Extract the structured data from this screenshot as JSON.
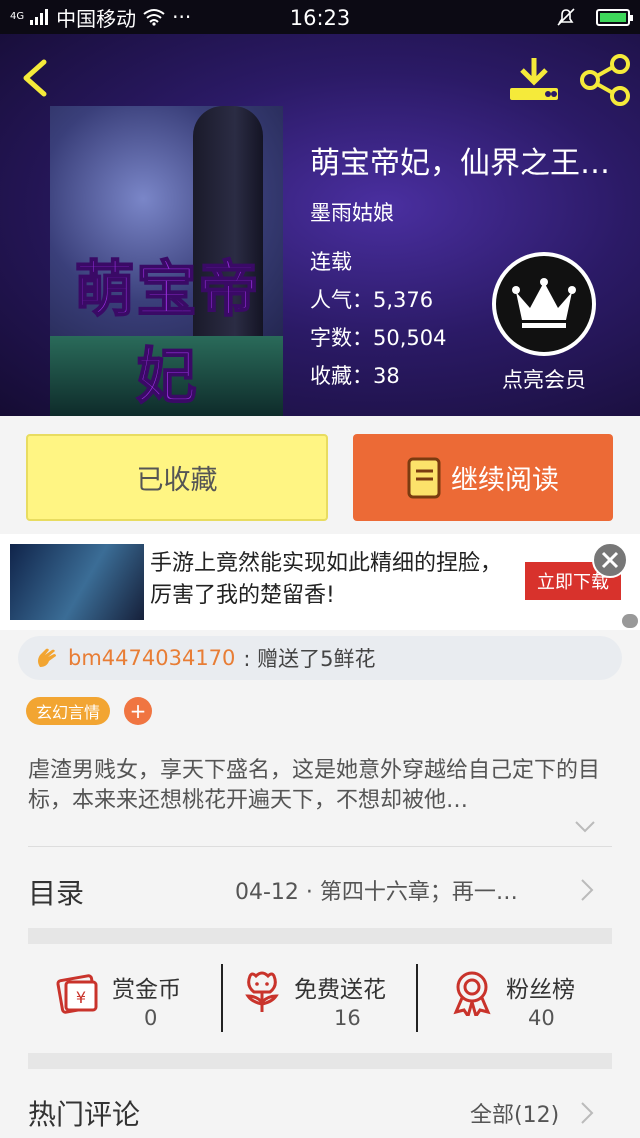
{
  "status_bar": {
    "signal": "4G",
    "carrier": "中国移动",
    "more": "···",
    "time": "16:23",
    "battery_color": "#3ed65b"
  },
  "book": {
    "title": "萌宝帝妃，仙界之王…",
    "cover_title": "萌宝帝妃",
    "author": "墨雨姑娘",
    "status": "连载",
    "popularity": "人气：5,376",
    "word_count": "字数：50,504",
    "favorites": "收藏：38"
  },
  "vip": {
    "label": "点亮会员"
  },
  "actions": {
    "favorited_label": "已收藏",
    "continue_label": "继续阅读"
  },
  "ad": {
    "text": "手游上竟然能实现如此精细的捏脸，厉害了我的楚留香!",
    "cta": "立即下载"
  },
  "gift_ticker": {
    "user": "bm4474034170",
    "action": ": 赠送了5鲜花"
  },
  "tags": [
    "玄幻言情"
  ],
  "tag_add": "+",
  "description": "虐渣男贱女，享天下盛名，这是她意外穿越给自己定下的目标，本来来还想桃花开遍天下，不想却被他…",
  "toc": {
    "label": "目录",
    "latest": "04-12 · 第四十六章；再一…"
  },
  "stats": [
    {
      "label": "赏金币",
      "value": "0",
      "icon": "reward-coin-icon"
    },
    {
      "label": "免费送花",
      "value": "16",
      "icon": "flower-icon"
    },
    {
      "label": "粉丝榜",
      "value": "40",
      "icon": "ribbon-icon"
    }
  ],
  "comments": {
    "title": "热门评论",
    "all_label": "全部(12)"
  },
  "colors": {
    "accent_orange": "#ec6a36",
    "fav_yellow": "#fff583",
    "icon_red": "#c9332b",
    "header_purple": "#2b1a66"
  }
}
